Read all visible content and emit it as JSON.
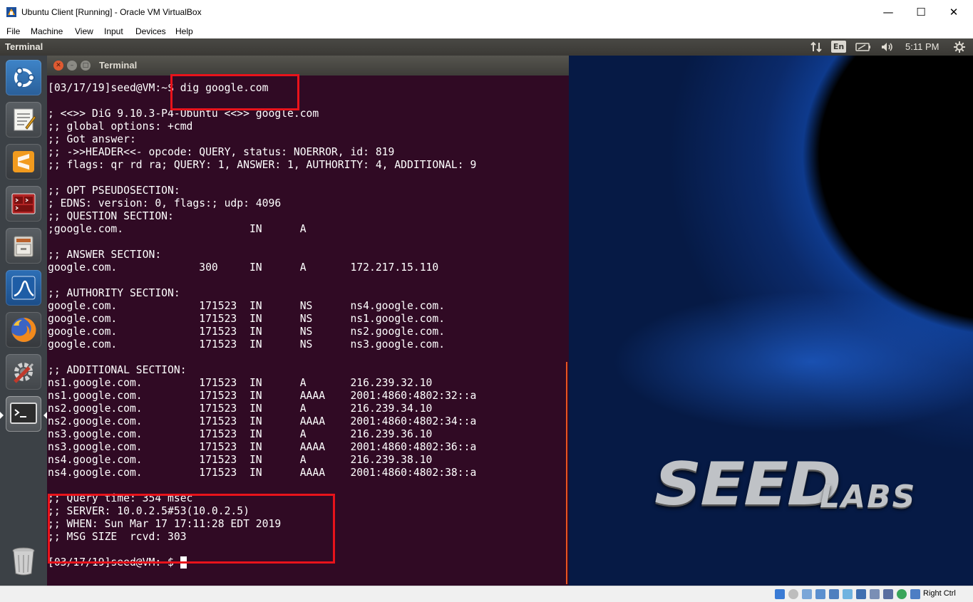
{
  "host_window": {
    "title": "Ubuntu Client [Running] - Oracle VM VirtualBox",
    "minimize": "—",
    "maximize": "☐",
    "close": "✕",
    "menu": [
      "File",
      "Machine",
      "View",
      "Input",
      "Devices",
      "Help"
    ]
  },
  "top_panel": {
    "app_title": "Terminal",
    "keyboard_layout": "En",
    "clock": "5:11 PM"
  },
  "launcher": {
    "items": [
      "ubuntu-dash-icon",
      "text-editor-icon",
      "sublime-text-icon",
      "terminal-red-icon",
      "file-manager-icon",
      "wireshark-icon",
      "firefox-icon",
      "system-settings-icon",
      "terminal-icon"
    ],
    "trash": "trash-icon"
  },
  "terminal": {
    "window_title": "Terminal",
    "lines": [
      "[03/17/19]seed@VM:~$ dig google.com",
      "",
      "; <<>> DiG 9.10.3-P4-Ubuntu <<>> google.com",
      ";; global options: +cmd",
      ";; Got answer:",
      ";; ->>HEADER<<- opcode: QUERY, status: NOERROR, id: 819",
      ";; flags: qr rd ra; QUERY: 1, ANSWER: 1, AUTHORITY: 4, ADDITIONAL: 9",
      "",
      ";; OPT PSEUDOSECTION:",
      "; EDNS: version: 0, flags:; udp: 4096",
      ";; QUESTION SECTION:",
      ";google.com.                    IN      A",
      "",
      ";; ANSWER SECTION:",
      "google.com.             300     IN      A       172.217.15.110",
      "",
      ";; AUTHORITY SECTION:",
      "google.com.             171523  IN      NS      ns4.google.com.",
      "google.com.             171523  IN      NS      ns1.google.com.",
      "google.com.             171523  IN      NS      ns2.google.com.",
      "google.com.             171523  IN      NS      ns3.google.com.",
      "",
      ";; ADDITIONAL SECTION:",
      "ns1.google.com.         171523  IN      A       216.239.32.10",
      "ns1.google.com.         171523  IN      AAAA    2001:4860:4802:32::a",
      "ns2.google.com.         171523  IN      A       216.239.34.10",
      "ns2.google.com.         171523  IN      AAAA    2001:4860:4802:34::a",
      "ns3.google.com.         171523  IN      A       216.239.36.10",
      "ns3.google.com.         171523  IN      AAAA    2001:4860:4802:36::a",
      "ns4.google.com.         171523  IN      A       216.239.38.10",
      "ns4.google.com.         171523  IN      AAAA    2001:4860:4802:38::a",
      "",
      ";; Query time: 354 msec",
      ";; SERVER: 10.0.2.5#53(10.0.2.5)",
      ";; WHEN: Sun Mar 17 17:11:28 EDT 2019",
      ";; MSG SIZE  rcvd: 303",
      ""
    ],
    "prompt": "[03/17/19]seed@VM:~$ "
  },
  "desktop": {
    "logo_main": "SEED",
    "logo_sub": "LABS"
  },
  "status_bar": {
    "host_key_label": "Right Ctrl"
  },
  "colors": {
    "terminal_bg": "#300a24",
    "highlight_box": "#e8131b",
    "ubuntu_orange": "#e95420"
  }
}
